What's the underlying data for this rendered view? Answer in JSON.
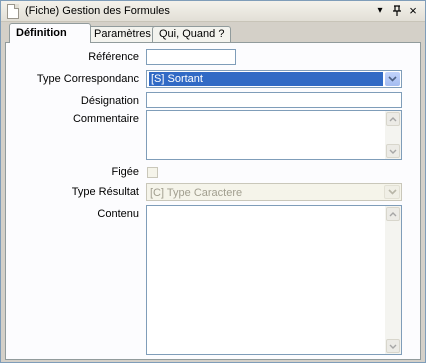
{
  "window": {
    "title": "(Fiche) Gestion des Formules",
    "dropdown_glyph": "▾",
    "pin_glyph": "‡",
    "close_glyph": "×"
  },
  "tabs": [
    {
      "label": "Définition",
      "active": true
    },
    {
      "label": "Paramètres",
      "active": false
    },
    {
      "label": "Qui, Quand ?",
      "active": false
    }
  ],
  "form": {
    "reference": {
      "label": "Référence",
      "value": ""
    },
    "type_correspondance": {
      "label": "Type Correspondanc",
      "value": "[S] Sortant"
    },
    "designation": {
      "label": "Désignation",
      "value": ""
    },
    "commentaire": {
      "label": "Commentaire",
      "value": ""
    },
    "figee": {
      "label": "Figée",
      "checked": false
    },
    "type_resultat": {
      "label": "Type Résultat",
      "value": "[C] Type Caractere",
      "disabled": true
    },
    "contenu": {
      "label": "Contenu",
      "value": ""
    }
  },
  "colors": {
    "selection": "#316ac5",
    "panel": "#fcfcfe",
    "chrome": "#d4d0c8"
  }
}
